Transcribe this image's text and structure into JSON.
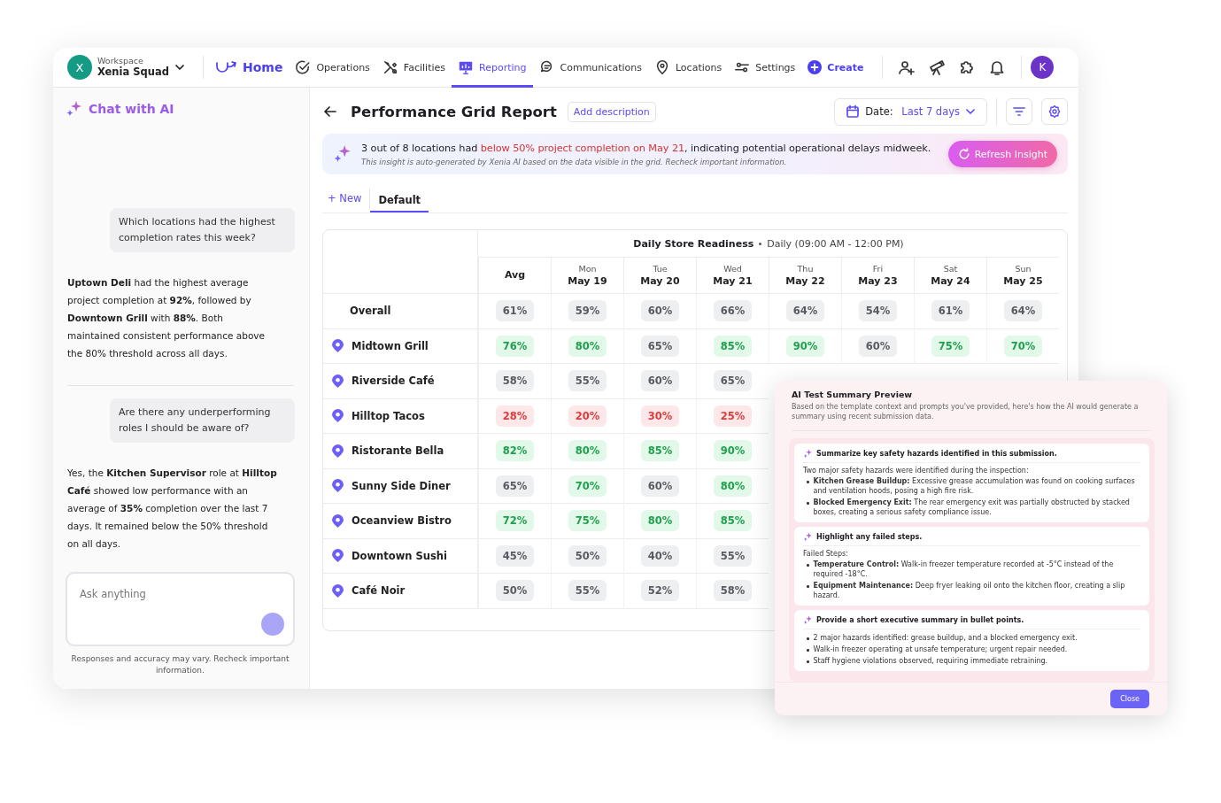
{
  "workspace": {
    "caption": "Workspace",
    "name": "Xenia Squad",
    "avatar": "X"
  },
  "nav": [
    {
      "kind": "home",
      "label": "Home",
      "selected": false
    },
    {
      "kind": "operations",
      "label": "Operations",
      "selected": false
    },
    {
      "kind": "facilities",
      "label": "Facilities",
      "selected": false
    },
    {
      "kind": "reporting",
      "label": "Reporting",
      "selected": true
    },
    {
      "kind": "communications",
      "label": "Communications",
      "selected": false
    },
    {
      "kind": "locations",
      "label": "Locations",
      "selected": false
    },
    {
      "kind": "settings",
      "label": "Settings",
      "selected": false
    },
    {
      "kind": "create",
      "label": "Create",
      "selected": false
    }
  ],
  "toolbar_icons": [
    {
      "kind": "user-add"
    },
    {
      "kind": "telescope"
    },
    {
      "kind": "puzzle"
    },
    {
      "kind": "bell"
    }
  ],
  "user_avatar": "K",
  "chat": {
    "title": "Chat with AI",
    "messages": [
      {
        "kind": "user",
        "text": "Which locations had the highest completion rates this week?"
      },
      {
        "kind": "ai",
        "text": "**Uptown Deli** had the highest average project completion at **92%**, followed by **Downtown Grill** with **88%**. Both maintained consistent performance above the 80% threshold across all days."
      },
      {
        "kind": "divider"
      },
      {
        "kind": "user",
        "text": "Are there any underperforming roles I should be aware of?"
      },
      {
        "kind": "ai",
        "text": "Yes, the **Kitchen Supervisor** role at **Hilltop Café** showed low performance with an average of **35%** completion over the last 7 days. It remained below the 50% threshold on all days."
      }
    ],
    "input_placeholder": "Ask anything",
    "disclaimer": "Responses and accuracy may vary. Recheck important information."
  },
  "report": {
    "title": "Performance Grid Report",
    "add_description": "Add description",
    "date_label": "Date:",
    "date_value": "Last 7 days",
    "insight": {
      "parts": [
        {
          "text": "3 out of 8 locations had ",
          "emphasis": false
        },
        {
          "text": "below 50% project completion on May 21",
          "emphasis": true
        },
        {
          "text": ", indicating potential operational delays midweek.",
          "emphasis": false
        }
      ],
      "note": "This insight is auto-generated by Xenia AI based on the data visible in the grid. Recheck important information.",
      "button": "Refresh Insight"
    },
    "views": [
      {
        "label": "+ New",
        "kind": "new",
        "selected": false
      },
      {
        "label": "Default",
        "kind": "view",
        "selected": true
      }
    ],
    "table": {
      "group_title": "Daily Store Readiness",
      "group_subtitle": "Daily (09:00 AM - 12:00 PM)",
      "columns": [
        {
          "date": "Avg"
        },
        {
          "day": "Mon",
          "date": "May 19"
        },
        {
          "day": "Tue",
          "date": "May 20"
        },
        {
          "day": "Wed",
          "date": "May 21"
        },
        {
          "day": "Thu",
          "date": "May 22"
        },
        {
          "day": "Fri",
          "date": "May 23"
        },
        {
          "day": "Sat",
          "date": "May 24"
        },
        {
          "day": "Sun",
          "date": "May 25"
        }
      ],
      "rows": [
        {
          "name": "Overall",
          "kind": "total",
          "cells": [
            {
              "value": "61%",
              "kind": "neutral"
            },
            {
              "value": "59%",
              "kind": "neutral"
            },
            {
              "value": "60%",
              "kind": "neutral"
            },
            {
              "value": "66%",
              "kind": "neutral"
            },
            {
              "value": "64%",
              "kind": "neutral"
            },
            {
              "value": "54%",
              "kind": "neutral"
            },
            {
              "value": "61%",
              "kind": "neutral"
            },
            {
              "value": "64%",
              "kind": "neutral"
            }
          ]
        },
        {
          "name": "Midtown Grill",
          "kind": "location",
          "cells": [
            {
              "value": "76%",
              "kind": "good"
            },
            {
              "value": "80%",
              "kind": "good"
            },
            {
              "value": "65%",
              "kind": "neutral"
            },
            {
              "value": "85%",
              "kind": "good"
            },
            {
              "value": "90%",
              "kind": "good"
            },
            {
              "value": "60%",
              "kind": "neutral"
            },
            {
              "value": "75%",
              "kind": "good"
            },
            {
              "value": "70%",
              "kind": "good"
            }
          ]
        },
        {
          "name": "Riverside Café",
          "kind": "location",
          "cells": [
            {
              "value": "58%",
              "kind": "neutral"
            },
            {
              "value": "55%",
              "kind": "neutral"
            },
            {
              "value": "60%",
              "kind": "neutral"
            },
            {
              "value": "65%",
              "kind": "neutral"
            }
          ]
        },
        {
          "name": "Hilltop Tacos",
          "kind": "location",
          "cells": [
            {
              "value": "28%",
              "kind": "bad"
            },
            {
              "value": "20%",
              "kind": "bad"
            },
            {
              "value": "30%",
              "kind": "bad"
            },
            {
              "value": "25%",
              "kind": "bad"
            }
          ]
        },
        {
          "name": "Ristorante Bella",
          "kind": "location",
          "cells": [
            {
              "value": "82%",
              "kind": "good"
            },
            {
              "value": "80%",
              "kind": "good"
            },
            {
              "value": "85%",
              "kind": "good"
            },
            {
              "value": "90%",
              "kind": "good"
            }
          ]
        },
        {
          "name": "Sunny Side Diner",
          "kind": "location",
          "cells": [
            {
              "value": "65%",
              "kind": "neutral"
            },
            {
              "value": "70%",
              "kind": "good"
            },
            {
              "value": "60%",
              "kind": "neutral"
            },
            {
              "value": "80%",
              "kind": "good"
            }
          ]
        },
        {
          "name": "Oceanview Bistro",
          "kind": "location",
          "cells": [
            {
              "value": "72%",
              "kind": "good"
            },
            {
              "value": "75%",
              "kind": "good"
            },
            {
              "value": "80%",
              "kind": "good"
            },
            {
              "value": "85%",
              "kind": "good"
            }
          ]
        },
        {
          "name": "Downtown Sushi",
          "kind": "location",
          "cells": [
            {
              "value": "45%",
              "kind": "neutral"
            },
            {
              "value": "50%",
              "kind": "neutral"
            },
            {
              "value": "40%",
              "kind": "neutral"
            },
            {
              "value": "55%",
              "kind": "neutral"
            }
          ]
        },
        {
          "name": "Café Noir",
          "kind": "location",
          "cells": [
            {
              "value": "50%",
              "kind": "neutral"
            },
            {
              "value": "55%",
              "kind": "neutral"
            },
            {
              "value": "52%",
              "kind": "neutral"
            },
            {
              "value": "58%",
              "kind": "neutral"
            }
          ]
        }
      ]
    }
  },
  "dialog": {
    "title": "AI Test Summary Preview",
    "subtitle": "Based on the template context and prompts you've provided, here's how the AI would generate a summary using recent submission data.",
    "sections": [
      {
        "prompt": "Summarize key safety hazards identified in this submission.",
        "intro": "Two major safety hazards were identified during the inspection:",
        "bullets": [
          "**Kitchen Grease Buildup:** Excessive grease accumulation was found on cooking surfaces and ventilation hoods, posing a high fire risk.",
          "**Blocked Emergency Exit:** The rear emergency exit was partially obstructed by stacked boxes, creating a serious safety compliance issue."
        ]
      },
      {
        "prompt": "Highlight any failed steps.",
        "intro": "Failed Steps:",
        "bullets": [
          "**Temperature Control:** Walk-in freezer temperature recorded at -5°C instead of the required -18°C.",
          "**Equipment Maintenance:** Deep fryer leaking oil onto the kitchen floor, creating a slip hazard."
        ]
      },
      {
        "prompt": "Provide a short executive summary in bullet points.",
        "bullets": [
          "2 major hazards identified: grease buildup, and a blocked emergency exit.",
          "Walk-in freezer operating at unsafe temperature; urgent repair needed.",
          "Staff hygiene violations observed, requiring immediate retraining."
        ]
      }
    ],
    "close": "Close"
  }
}
